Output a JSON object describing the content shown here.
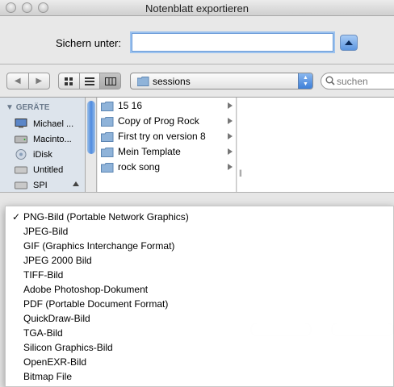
{
  "window": {
    "title": "Notenblatt exportieren"
  },
  "save": {
    "label": "Sichern unter:",
    "value": ""
  },
  "toolbar": {
    "path_popup": "sessions",
    "search_placeholder": "suchen"
  },
  "sidebar": {
    "header": "GERÄTE",
    "items": [
      {
        "label": "Michael ...",
        "icon": "computer-icon"
      },
      {
        "label": "Macinto...",
        "icon": "hard-drive-icon"
      },
      {
        "label": "iDisk",
        "icon": "idisk-icon"
      },
      {
        "label": "Untitled",
        "icon": "disk-icon"
      },
      {
        "label": "SPI",
        "icon": "disk-icon"
      }
    ]
  },
  "column": {
    "items": [
      {
        "label": "15 16"
      },
      {
        "label": "Copy of Prog Rock"
      },
      {
        "label": "First try on version 8"
      },
      {
        "label": "Mein Template"
      },
      {
        "label": "rock song"
      }
    ]
  },
  "format_menu": {
    "selected_index": 0,
    "items": [
      "PNG-Bild (Portable Network Graphics)",
      "JPEG-Bild",
      "GIF (Graphics Interchange Format)",
      "JPEG 2000 Bild",
      "TIFF-Bild",
      "Adobe Photoshop-Dokument",
      "PDF (Portable Document Format)",
      "QuickDraw-Bild",
      "TGA-Bild",
      "Silicon Graphics-Bild",
      "OpenEXR-Bild",
      "Bitmap File"
    ]
  },
  "colors": {
    "accent": "#3d7fd8",
    "sidebar_bg": "#dde4ec",
    "window_bg": "#e8e8e8"
  }
}
